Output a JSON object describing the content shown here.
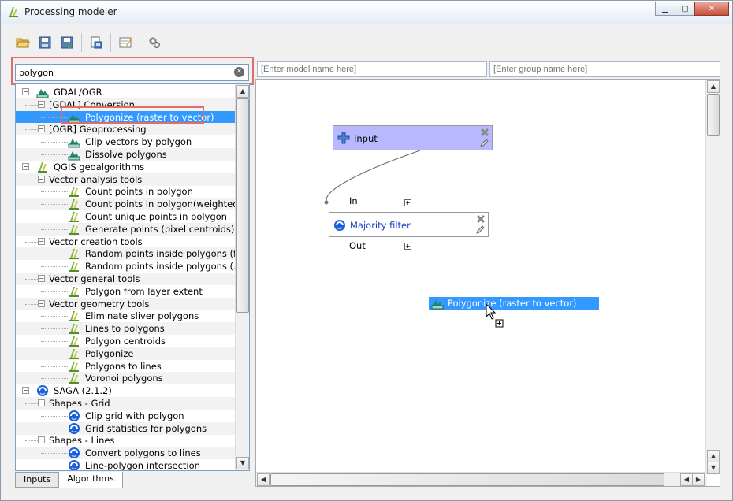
{
  "window": {
    "title": "Processing modeler"
  },
  "search": {
    "value": "polygon"
  },
  "model": {
    "name_placeholder": "[Enter model name here]",
    "group_placeholder": "[Enter group name here]"
  },
  "tree": [
    {
      "label": "GDAL/OGR",
      "level": 0,
      "icon": "gdal-icon",
      "expander": "−"
    },
    {
      "label": "[GDAL] Conversion",
      "level": 1,
      "expander": "−"
    },
    {
      "label": "Polygonize (raster to vector)",
      "level": 2,
      "icon": "gdal-icon",
      "selected": true
    },
    {
      "label": "[OGR] Geoprocessing",
      "level": 1,
      "expander": "−"
    },
    {
      "label": "Clip vectors by polygon",
      "level": 2,
      "icon": "gdal-icon"
    },
    {
      "label": "Dissolve polygons",
      "level": 2,
      "icon": "gdal-icon"
    },
    {
      "label": "QGIS geoalgorithms",
      "level": 0,
      "icon": "qgis-icon",
      "expander": "−"
    },
    {
      "label": "Vector analysis tools",
      "level": 1,
      "expander": "−"
    },
    {
      "label": "Count points in polygon",
      "level": 2,
      "icon": "qgis-icon"
    },
    {
      "label": "Count points in polygon(weighted)",
      "level": 2,
      "icon": "qgis-icon"
    },
    {
      "label": "Count unique points in polygon",
      "level": 2,
      "icon": "qgis-icon"
    },
    {
      "label": "Generate points (pixel centroids) i...",
      "level": 2,
      "icon": "qgis-icon"
    },
    {
      "label": "Vector creation tools",
      "level": 1,
      "expander": "−"
    },
    {
      "label": "Random points inside polygons (f...",
      "level": 2,
      "icon": "qgis-icon"
    },
    {
      "label": "Random points inside polygons (...",
      "level": 2,
      "icon": "qgis-icon"
    },
    {
      "label": "Vector general tools",
      "level": 1,
      "expander": "−"
    },
    {
      "label": "Polygon from layer extent",
      "level": 2,
      "icon": "qgis-icon"
    },
    {
      "label": "Vector geometry tools",
      "level": 1,
      "expander": "−"
    },
    {
      "label": "Eliminate sliver polygons",
      "level": 2,
      "icon": "qgis-icon"
    },
    {
      "label": "Lines to polygons",
      "level": 2,
      "icon": "qgis-icon"
    },
    {
      "label": "Polygon centroids",
      "level": 2,
      "icon": "qgis-icon"
    },
    {
      "label": "Polygonize",
      "level": 2,
      "icon": "qgis-icon"
    },
    {
      "label": "Polygons to lines",
      "level": 2,
      "icon": "qgis-icon"
    },
    {
      "label": "Voronoi polygons",
      "level": 2,
      "icon": "qgis-icon"
    },
    {
      "label": "SAGA (2.1.2)",
      "level": 0,
      "icon": "saga-icon",
      "expander": "−"
    },
    {
      "label": "Shapes - Grid",
      "level": 1,
      "expander": "−"
    },
    {
      "label": "Clip grid with polygon",
      "level": 2,
      "icon": "saga-icon"
    },
    {
      "label": "Grid statistics for polygons",
      "level": 2,
      "icon": "saga-icon"
    },
    {
      "label": "Shapes - Lines",
      "level": 1,
      "expander": "−"
    },
    {
      "label": "Convert polygons to lines",
      "level": 2,
      "icon": "saga-icon"
    },
    {
      "label": "Line-polygon intersection",
      "level": 2,
      "icon": "saga-icon"
    }
  ],
  "tabs": [
    {
      "label": "Inputs"
    },
    {
      "label": "Algorithms",
      "active": true
    }
  ],
  "canvas": {
    "input_node": {
      "label": "Input"
    },
    "majority_node": {
      "label": "Majority filter",
      "in_label": "In",
      "out_label": "Out"
    },
    "drag_item": {
      "label": "Polygonize (raster to vector)"
    }
  },
  "colors": {
    "selection": "#3399ff",
    "input_node": "#b8b8ff",
    "highlight_frame": "#e06c6c",
    "algorithm_link": "#1a3fc0"
  }
}
